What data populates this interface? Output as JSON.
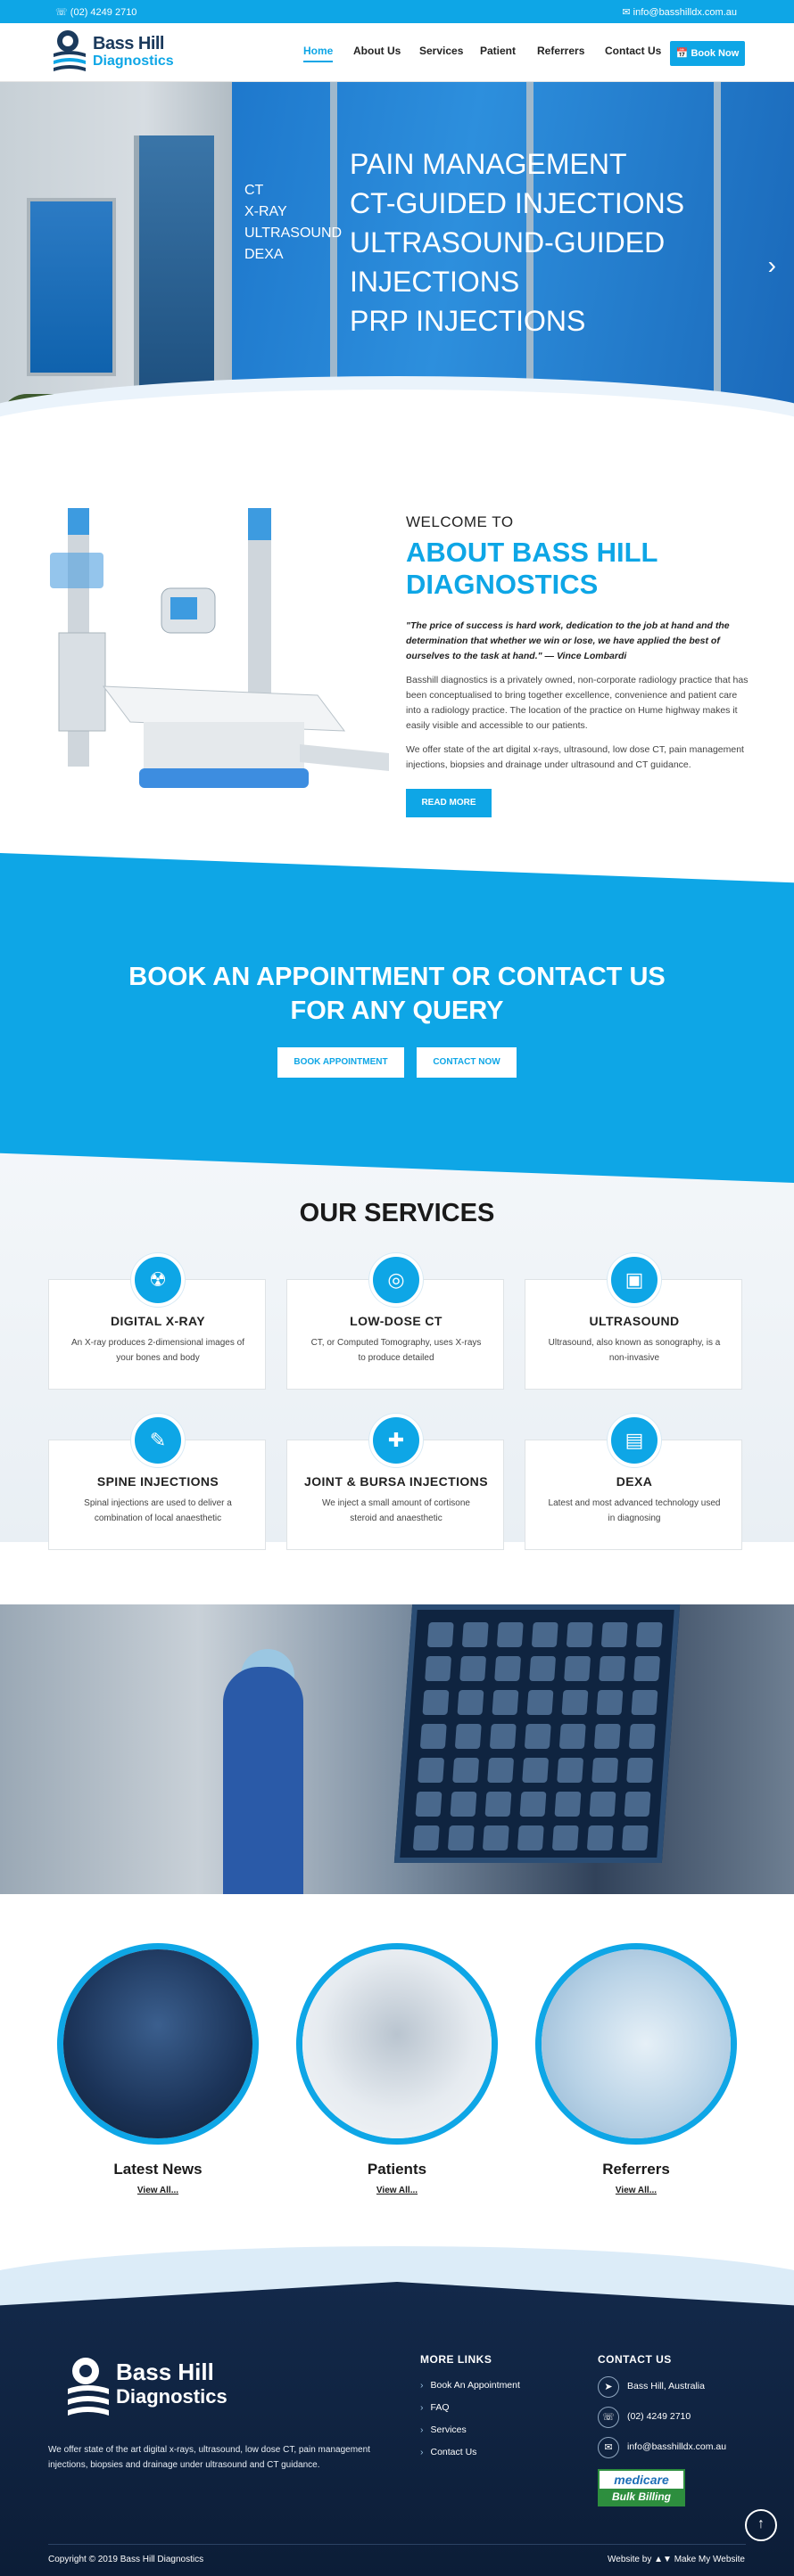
{
  "topbar": {
    "phone": "☏ (02) 4249 2710",
    "email": "✉ info@basshilldx.com.au"
  },
  "logo": {
    "line1": "Bass Hill",
    "line2": "Diagnostics"
  },
  "nav": {
    "items": [
      "Home",
      "About Us",
      "Services",
      "Patient",
      "Referrers",
      "Contact Us"
    ],
    "active": "Home",
    "book_now": "📅 Book Now"
  },
  "hero": {
    "list_small": [
      "CT",
      "X-RAY",
      "ULTRASOUND",
      "DEXA"
    ],
    "list_large": [
      "PAIN MANAGEMENT",
      "CT-GUIDED INJECTIONS",
      "ULTRASOUND-GUIDED",
      "INJECTIONS",
      "PRP INJECTIONS"
    ],
    "next_arrow": "›"
  },
  "about": {
    "welcome": "WELCOME TO",
    "title": "ABOUT BASS HILL DIAGNOSTICS",
    "quote": "\"The price of success is hard work, dedication to the job at hand and the determination that whether we win or lose, we have applied the best of ourselves to the task at hand.\" — Vince Lombardi",
    "p1": "Basshill diagnostics is a privately owned, non-corporate radiology practice that has been conceptualised to bring together excellence, convenience and patient care into a radiology practice. The location of the practice on Hume highway makes it easily visible and accessible to our patients.",
    "p2": "We offer state of the art digital x-rays, ultrasound, low dose CT, pain management injections, biopsies and drainage under ultrasound and CT guidance.",
    "read_more": "READ MORE"
  },
  "cta": {
    "line1": "BOOK AN APPOINTMENT OR CONTACT US",
    "line2": "FOR ANY QUERY",
    "btn_book": "BOOK APPOINTMENT",
    "btn_contact": "CONTACT NOW"
  },
  "services": {
    "title": "OUR SERVICES",
    "items": [
      {
        "name": "DIGITAL X-RAY",
        "desc": "An X-ray produces 2-dimensional images of your bones and body",
        "icon": "xray-icon"
      },
      {
        "name": "LOW-DOSE CT",
        "desc": "CT, or Computed Tomography, uses X-rays to produce detailed",
        "icon": "ct-scanner-icon"
      },
      {
        "name": "ULTRASOUND",
        "desc": "Ultrasound, also known as sonography, is a non-invasive",
        "icon": "ultrasound-icon"
      },
      {
        "name": "SPINE INJECTIONS",
        "desc": "Spinal injections are used to deliver a combination of local anaesthetic",
        "icon": "syringe-icon"
      },
      {
        "name": "JOINT & BURSA INJECTIONS",
        "desc": "We inject a small amount of cortisone steroid and anaesthetic",
        "icon": "joint-icon"
      },
      {
        "name": "DEXA",
        "desc": "Latest and most advanced technology used in diagnosing",
        "icon": "dexa-icon"
      }
    ]
  },
  "circles": [
    {
      "title": "Latest News",
      "link": "View All..."
    },
    {
      "title": "Patients",
      "link": "View All..."
    },
    {
      "title": "Referrers",
      "link": "View All..."
    }
  ],
  "footer": {
    "logo_line1": "Bass Hill",
    "logo_line2": "Diagnostics",
    "desc": "We offer state of the art digital x-rays, ultrasound, low dose CT, pain management injections, biopsies and drainage under ultrasound and CT guidance.",
    "links_title": "MORE LINKS",
    "links": [
      "Book An Appointment",
      "FAQ",
      "Services",
      "Contact Us"
    ],
    "contact_title": "CONTACT US",
    "address": "Bass Hill, Australia",
    "phone": "(02) 4249 2710",
    "email": "info@basshilldx.com.au",
    "medicare_1": "medicare",
    "medicare_2": "Bulk Billing",
    "copyright": "Copyright © 2019 Bass Hill Diagnostics",
    "website_by": "Website by",
    "make_my_website": "Make My Website"
  },
  "colors": {
    "accent": "#0ea6e6",
    "footer": "#13294a"
  }
}
